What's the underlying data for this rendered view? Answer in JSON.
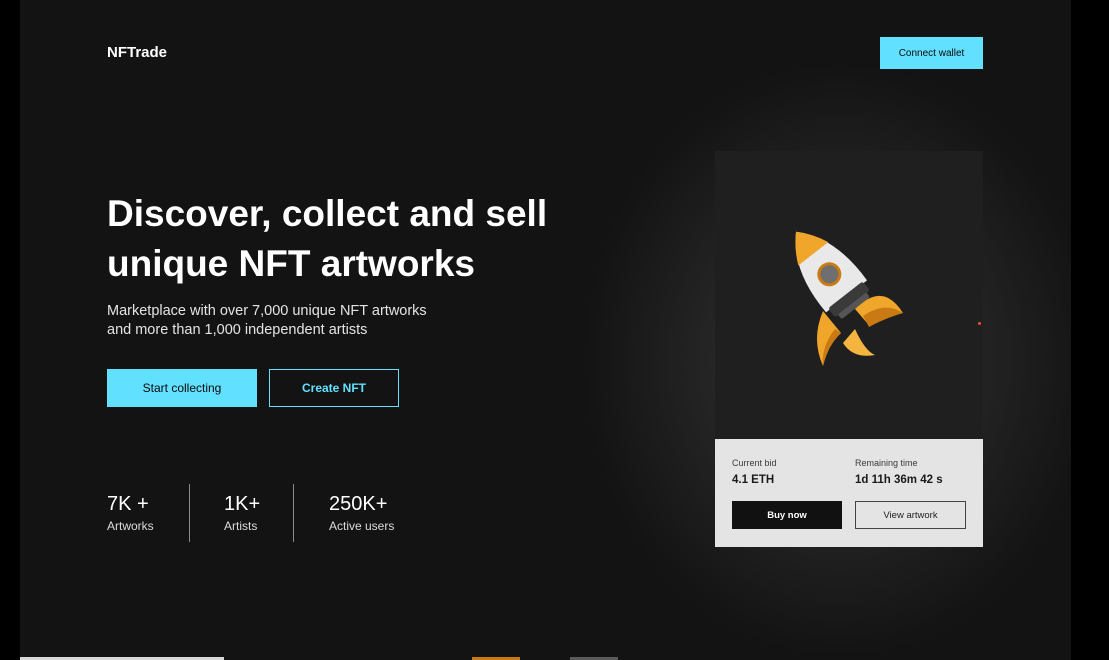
{
  "header": {
    "logo": "NFTrade",
    "connect_label": "Connect wallet"
  },
  "hero": {
    "title": "Discover, collect and sell unique NFT artworks",
    "subtitle": "Marketplace with over  7,000 unique NFT artworks\nand more than 1,000 independent artists",
    "primary_cta": "Start collecting",
    "secondary_cta": "Create NFT"
  },
  "stats": [
    {
      "value": "7K +",
      "label": "Artworks"
    },
    {
      "value": "1K+",
      "label": "Artists"
    },
    {
      "value": "250K+",
      "label": "Active users"
    }
  ],
  "card": {
    "image_icon": "rocket-icon",
    "current_bid_label": "Current bid",
    "current_bid_value": "4.1 ETH",
    "remaining_label": "Remaining time",
    "remaining_value": "1d 11h 36m 42 s",
    "buy_label": "Buy now",
    "view_label": "View artwork"
  },
  "colors": {
    "accent": "#62e0ff",
    "background": "#131313",
    "card_info_bg": "#e4e4e4",
    "buy_button": "#111111",
    "rocket_orange": "#f0a62a"
  }
}
